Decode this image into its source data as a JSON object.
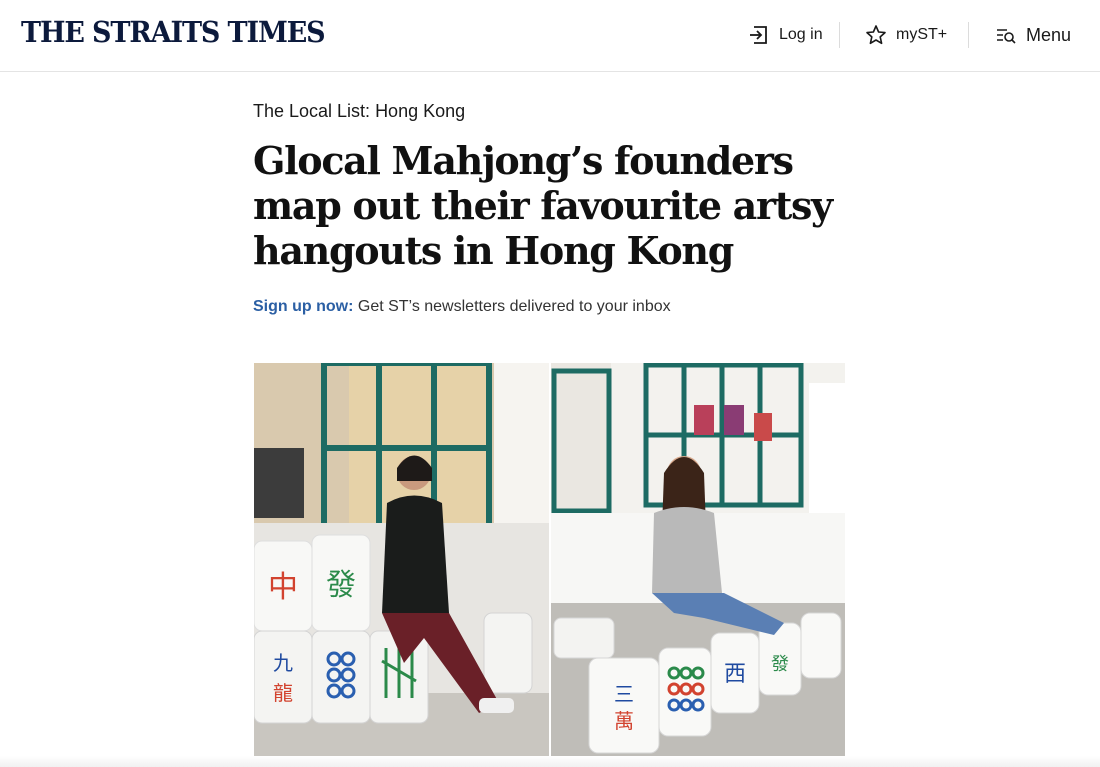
{
  "header": {
    "logo": "THE STRAITS TIMES",
    "login_label": "Log in",
    "myst_label": "myST+",
    "menu_label": "Menu"
  },
  "article": {
    "kicker": "The Local List: Hong Kong",
    "headline": "Glocal Mahjong’s founders map out their favourite artsy hangouts in Hong Kong",
    "signup_link": "Sign up now:",
    "signup_text": " Get ST’s newsletters delivered to your inbox"
  },
  "hero_image": {
    "description_icons": [
      "login-icon",
      "star-icon",
      "menu-search-icon"
    ],
    "tiles_left": [
      "中",
      "發",
      "九",
      "龍"
    ],
    "tiles_right": [
      "三",
      "萬",
      "西",
      "發"
    ]
  },
  "colors": {
    "brand": "#0c1a3c",
    "link": "#2b5fa4",
    "frame_green": "#1d6b63"
  }
}
